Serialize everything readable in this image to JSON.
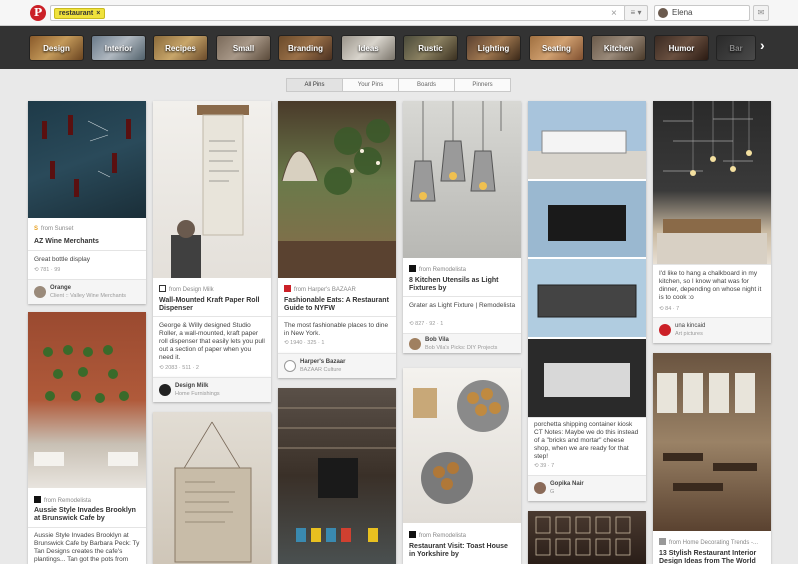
{
  "topbar": {
    "logo": "P",
    "search_chip": "restaurant",
    "chip_close": "×",
    "clear_glyph": "×",
    "menu_glyph": "≡ ▾",
    "user_name": "Elena",
    "msg_glyph": "✉"
  },
  "categories": [
    "Design",
    "Interior",
    "Recipes",
    "Small",
    "Branding",
    "Ideas",
    "Rustic",
    "Lighting",
    "Seating",
    "Kitchen",
    "Humor",
    "Bar"
  ],
  "next_glyph": "›",
  "tabs": [
    "All Pins",
    "Your Pins",
    "Boards",
    "Pinners"
  ],
  "pins": {
    "p1": {
      "source": "from Sunset",
      "title": "AZ Wine Merchants",
      "desc": "Great bottle display",
      "stats": "781 · 99",
      "pinner": "Orange",
      "board": "Client :: Valley Wine Merchants"
    },
    "p2": {
      "source": "from Remodelista",
      "title": "Aussie Style Invades Brooklyn at Brunswick Cafe by",
      "desc": "Aussie Style Invades Brooklyn at Brunswick Cafe by Barbara Peck: Ty Tan Designs creates the cafe's plantings... Tan got the pots from"
    },
    "p3": {
      "source": "from Design Milk",
      "title": "Wall-Mounted Kraft Paper Roll Dispenser",
      "desc": "George & Willy designed Studio Roller, a wall-mounted, kraft paper roll dispenser that easily lets you pull out a section of paper when you need it.",
      "stats": "2083 · 511 · 2",
      "pinner": "Design Milk",
      "board": "Home Furnishings"
    },
    "p4": {
      "source": "from Harper's BAZAAR",
      "title": "Fashionable Eats: A Restaurant Guide to NYFW",
      "desc": "The most fashionable places to dine in New York.",
      "stats": "1940 · 325 · 1",
      "pinner": "Harper's Bazaar",
      "board": "BAZAAR Culture"
    },
    "p5": {
      "source": "from Remodelista",
      "title": "8 Kitchen Utensils as Light Fixtures by",
      "desc": "Grater as Light Fixture | Remodelista",
      "stats": "827 · 92 · 1",
      "pinner": "Bob Vila",
      "board": "Bob Vila's Picks: DIY Projects"
    },
    "p6": {
      "source": "from Remodelista",
      "title": "Restaurant Visit: Toast House in Yorkshire by"
    },
    "p7": {
      "desc": "porchetta shipping container kiosk CT Notes: Maybe we do this instead of a \"bricks and mortar\" cheese shop, when we are ready for that step!",
      "stats": "39 · 7",
      "pinner": "Gopika Nair",
      "board": "G"
    },
    "p8": {
      "desc": "I'd like to hang a chalkboard in my kitchen, so I know what was for dinner, depending on whose night it is to cook :o",
      "stats": "84 · 7",
      "pinner": "una kincaid",
      "board": "Art pictures"
    },
    "p9": {
      "source": "from Home Decorating Trends -...",
      "title": "13 Stylish Restaurant Interior Design Ideas from The World"
    }
  },
  "colors": {
    "accent": "#cb2027",
    "chip": "#f0e23c",
    "catbar": "#333333"
  }
}
